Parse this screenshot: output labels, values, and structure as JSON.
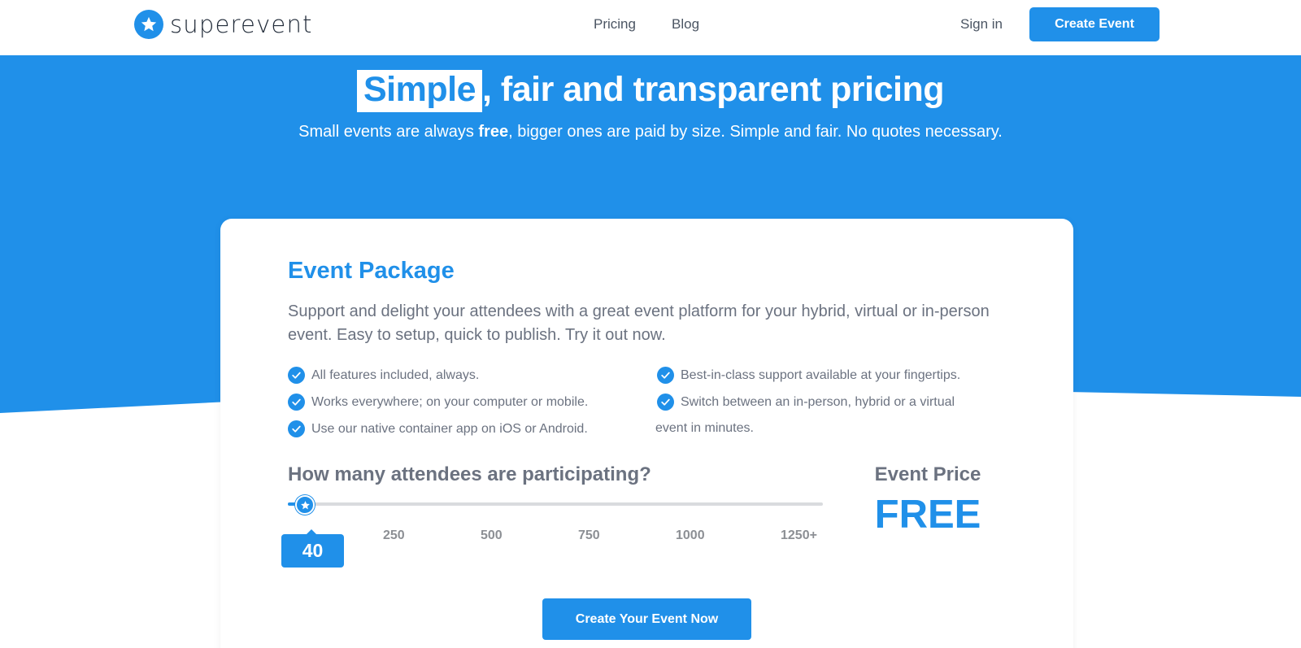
{
  "header": {
    "logo_text": "superevent",
    "nav": {
      "pricing": "Pricing",
      "blog": "Blog",
      "signin": "Sign in"
    },
    "create_button": "Create Event"
  },
  "hero": {
    "title_highlight": "Simple",
    "title_rest": ", fair and transparent pricing",
    "subtitle_pre": "Small events are always ",
    "subtitle_bold": "free",
    "subtitle_post": ", bigger ones are paid by size. Simple and fair. No quotes necessary."
  },
  "package": {
    "title": "Event Package",
    "description": "Support and delight your attendees with a great event platform for your hybrid, virtual or in-person event. Easy to setup, quick to publish. Try it out now.",
    "features_left": [
      "All features included, always.",
      "Works everywhere; on your computer or mobile.",
      "Use our native container app on iOS or Android."
    ],
    "features_right": [
      "Best-in-class support available at your fingertips.",
      "Switch between an in-person, hybrid or a virtual"
    ],
    "features_right_continuation": "event in minutes.",
    "question": "How many attendees are participating?",
    "slider": {
      "ticks": [
        "250",
        "500",
        "750",
        "1000",
        "1250+"
      ],
      "value": "40",
      "fraction": 0.032
    },
    "price_label": "Event Price",
    "price_value": "FREE",
    "cta": "Create Your Event Now"
  },
  "colors": {
    "accent": "#2090e9"
  },
  "icons": {
    "logo": "star-icon",
    "feature": "check-circle-icon",
    "thumb": "star-icon"
  }
}
